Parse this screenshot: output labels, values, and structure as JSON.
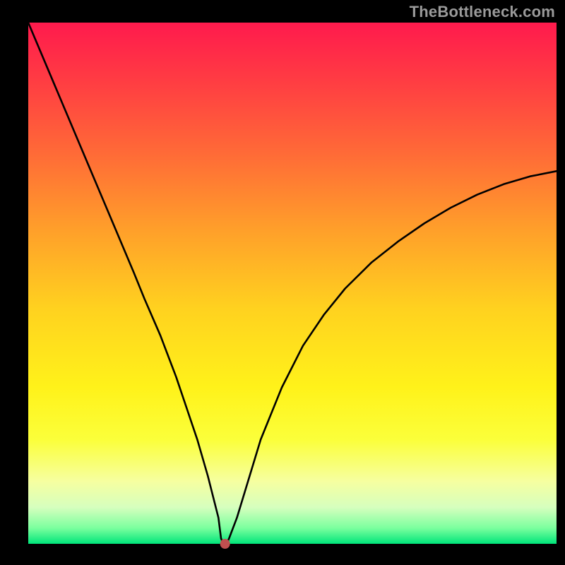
{
  "watermark": "TheBottleneck.com",
  "chart_data": {
    "type": "line",
    "title": "",
    "xlabel": "",
    "ylabel": "",
    "xlim": [
      0,
      100
    ],
    "ylim": [
      0,
      100
    ],
    "background": {
      "type": "vertical-gradient",
      "stops": [
        {
          "offset": 0.0,
          "color": "#ff1a4d"
        },
        {
          "offset": 0.12,
          "color": "#ff3f42"
        },
        {
          "offset": 0.25,
          "color": "#ff6a37"
        },
        {
          "offset": 0.4,
          "color": "#ffa02a"
        },
        {
          "offset": 0.55,
          "color": "#ffd21f"
        },
        {
          "offset": 0.7,
          "color": "#fff21a"
        },
        {
          "offset": 0.8,
          "color": "#fbff3a"
        },
        {
          "offset": 0.88,
          "color": "#f6ffa0"
        },
        {
          "offset": 0.93,
          "color": "#d6ffbe"
        },
        {
          "offset": 0.97,
          "color": "#7aff9e"
        },
        {
          "offset": 1.0,
          "color": "#00e57a"
        }
      ]
    },
    "series": [
      {
        "name": "bottleneck-curve",
        "color": "#000000",
        "x": [
          0,
          5,
          10,
          15,
          20,
          22,
          25,
          28,
          30,
          32,
          34,
          36,
          36.5,
          37,
          37.5,
          38,
          39.5,
          41,
          44,
          48,
          52,
          56,
          60,
          65,
          70,
          75,
          80,
          85,
          90,
          95,
          100
        ],
        "values": [
          100,
          88,
          76,
          64,
          52,
          47,
          40,
          32,
          26,
          20,
          13,
          5,
          1,
          0,
          0,
          1,
          5,
          10,
          20,
          30,
          38,
          44,
          49,
          54,
          58,
          61.5,
          64.5,
          67,
          69,
          70.5,
          71.5
        ]
      }
    ],
    "marker": {
      "name": "optimal-point",
      "x": 37.25,
      "y": 0,
      "color": "#c05050",
      "radius_px": 7
    }
  }
}
